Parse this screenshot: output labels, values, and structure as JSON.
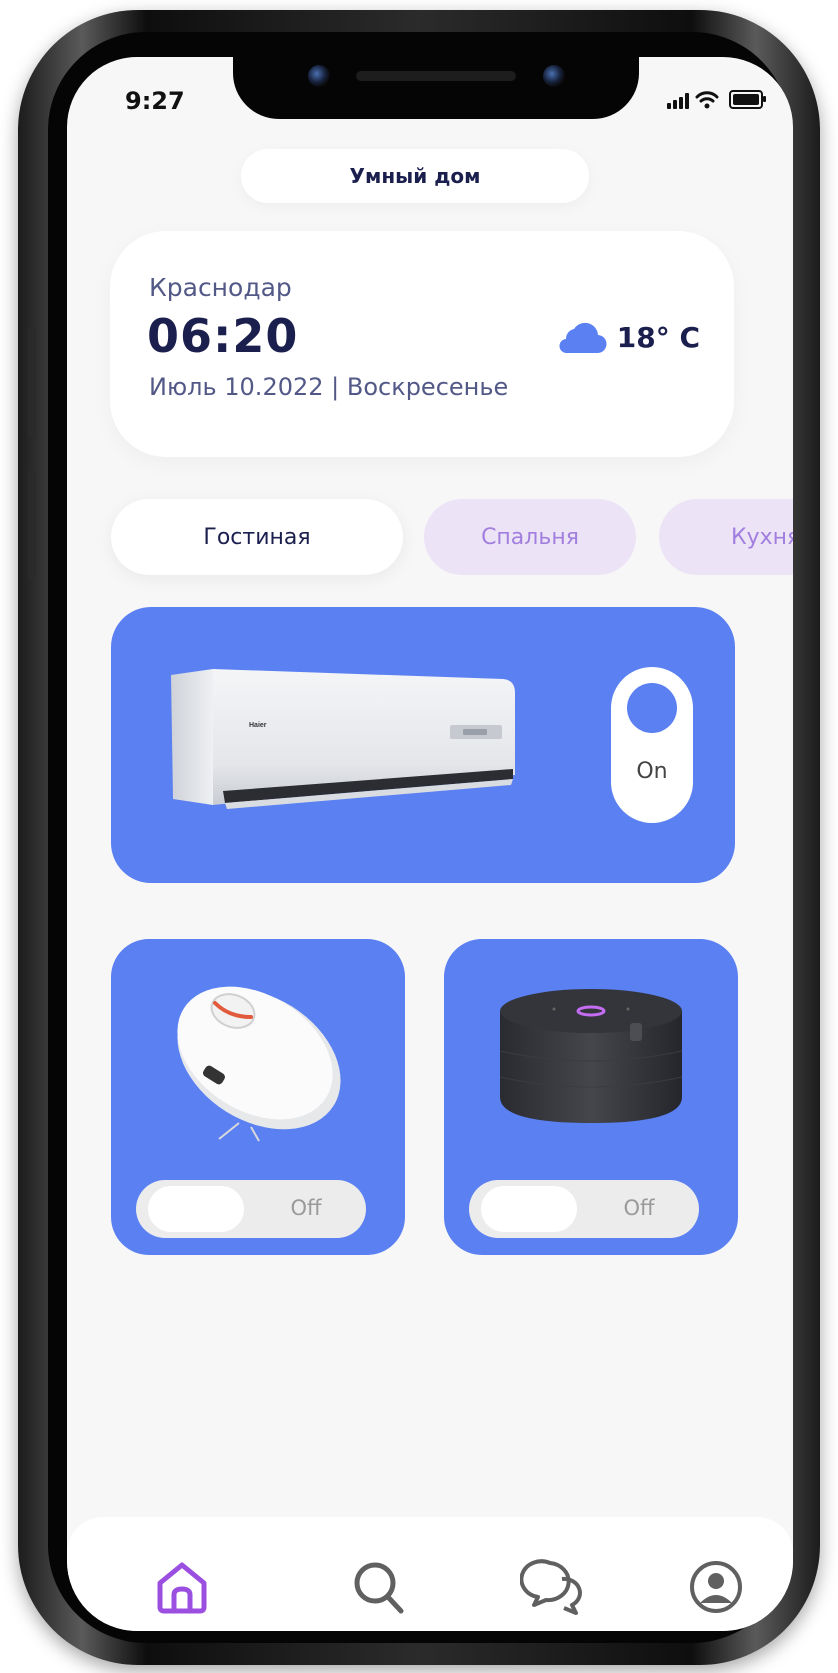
{
  "status_bar": {
    "time": "9:27"
  },
  "header": {
    "title": "Умный дом"
  },
  "weather": {
    "city": "Краснодар",
    "time": "06:20",
    "date": "Июль 10.2022 | Воскресенье",
    "temperature": "18° C",
    "icon": "cloud-icon"
  },
  "rooms": {
    "tabs": [
      {
        "label": "Гостиная",
        "active": true
      },
      {
        "label": "Спальня",
        "active": false
      },
      {
        "label": "Кухня",
        "active": false
      }
    ]
  },
  "devices": {
    "air_conditioner": {
      "state_label": "On",
      "brand": "Haier"
    },
    "vacuum": {
      "state_label": "Off"
    },
    "speaker": {
      "state_label": "Off"
    }
  },
  "nav": {
    "items": [
      "home-icon",
      "search-icon",
      "chat-icon",
      "profile-icon"
    ],
    "active": "home-icon"
  },
  "colors": {
    "accent": "#5a80f2",
    "title": "#1b1f4e",
    "tab_inactive_bg": "#ece4f6",
    "tab_inactive_text": "#a27fde",
    "nav_active": "#9b4fe0"
  }
}
